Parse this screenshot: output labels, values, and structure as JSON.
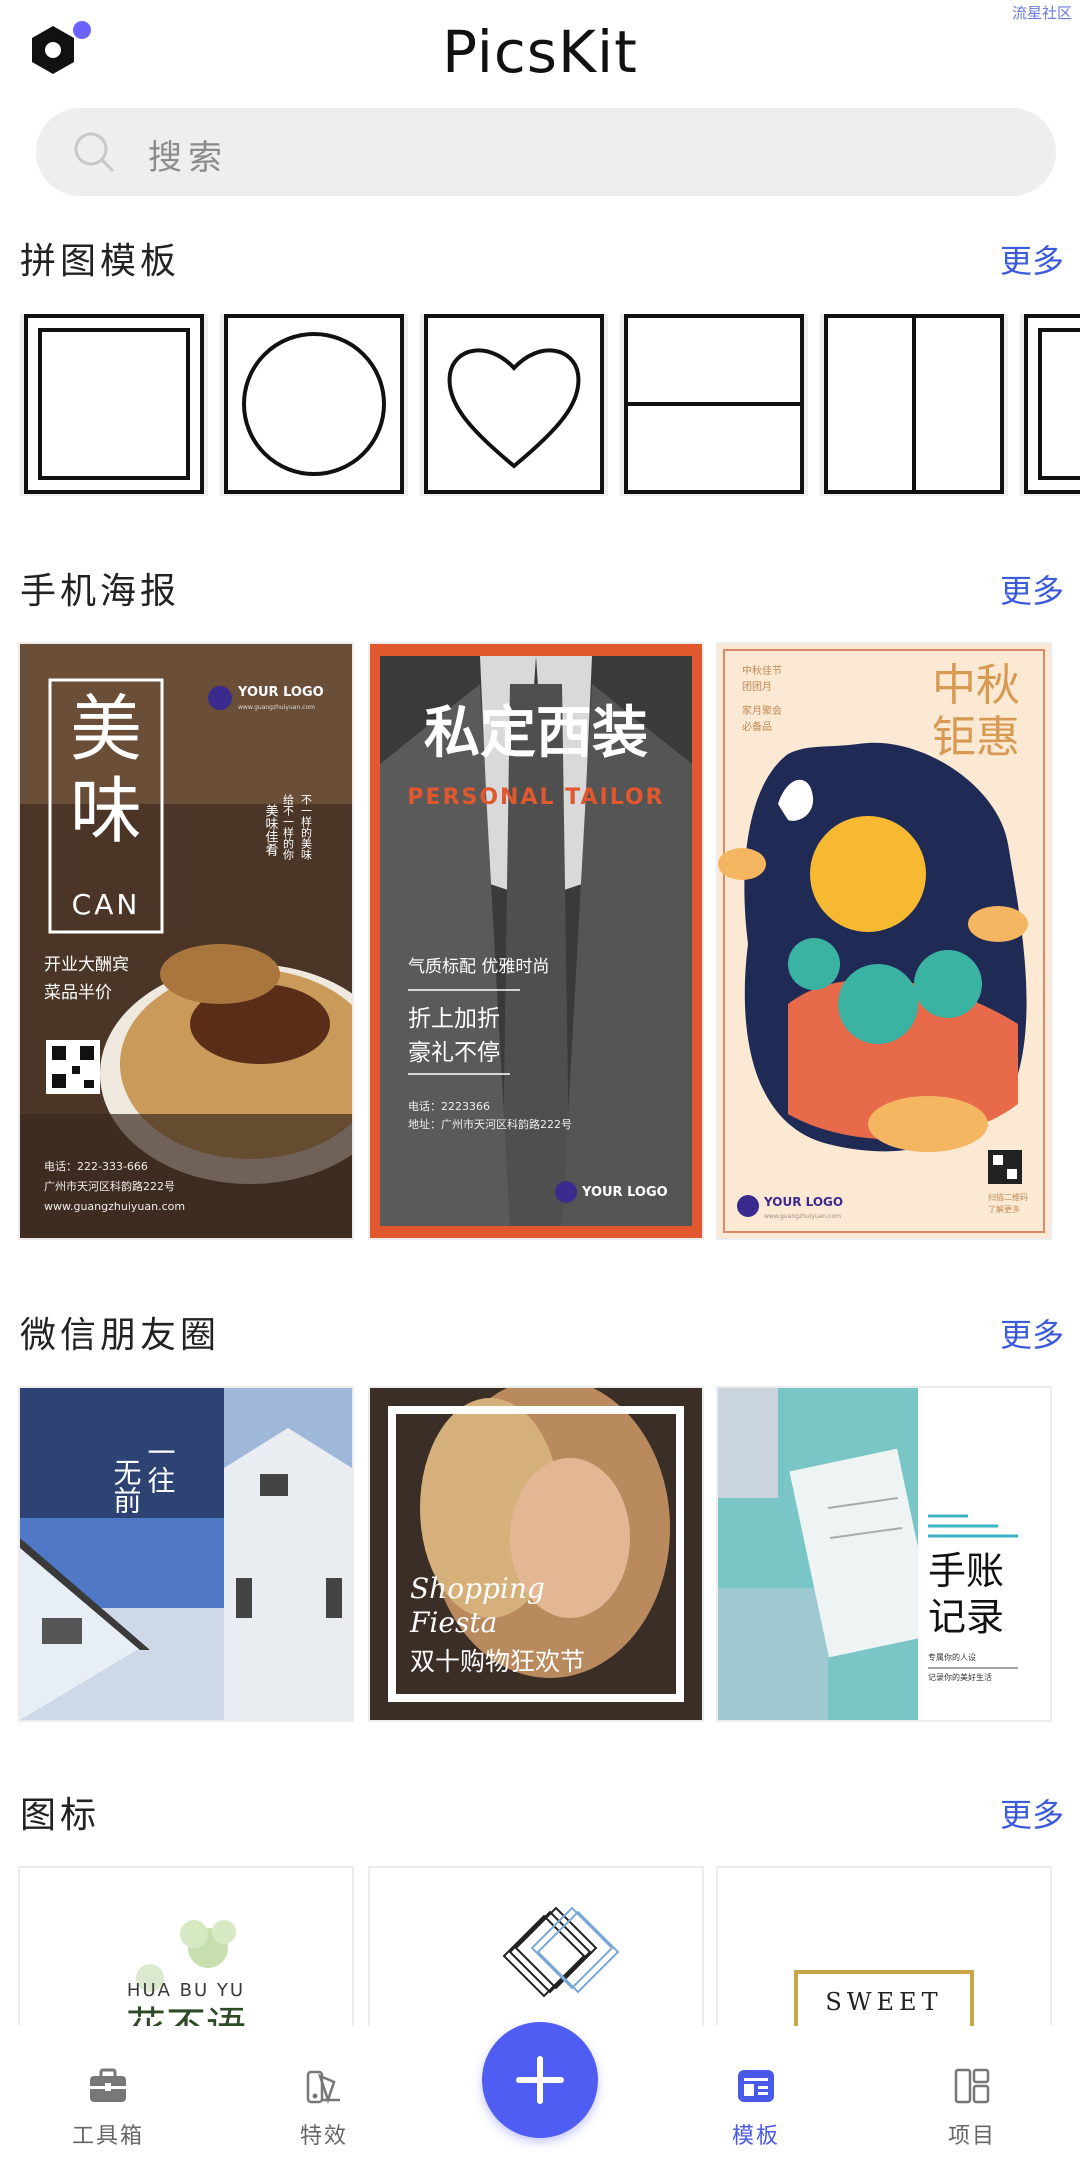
{
  "watermark": "流星社区",
  "app": {
    "title": "PicsKit"
  },
  "search": {
    "placeholder": "搜索"
  },
  "sections": {
    "collage": {
      "title": "拼图模板",
      "more": "更多"
    },
    "poster": {
      "title": "手机海报",
      "more": "更多"
    },
    "moments": {
      "title": "微信朋友圈",
      "more": "更多"
    },
    "icons": {
      "title": "图标",
      "more": "更多"
    }
  },
  "collage_templates": [
    "square-frame",
    "circle",
    "heart",
    "split-horizontal",
    "split-vertical",
    "square-frame"
  ],
  "posters": [
    {
      "title_1": "美",
      "title_2": "味",
      "en": "CAN",
      "logo": "YOUR LOGO",
      "url": "www.guangzhuiyuan.com",
      "side_1": "美味佳肴",
      "side_2": "不一样的美味",
      "side_3": "给不一样的你",
      "line_1": "开业大酬宾",
      "line_2": "菜品半价",
      "phone": "电话：222-333-666",
      "address": "广州市天河区科韵路222号",
      "site": "www.guangzhuiyuan.com"
    },
    {
      "title": "私定西装",
      "subtitle": "PERSONAL  TAILOR",
      "line_1": "气质标配 优雅时尚",
      "line_2": "折上加折",
      "line_3": "豪礼不停",
      "phone": "电话：2223366",
      "address": "地址：广州市天河区科韵路222号",
      "logo": "YOUR LOGO"
    },
    {
      "top_1": "中秋佳节",
      "top_2": "团团月",
      "top_3": "家月聚会",
      "top_4": "必备品",
      "title_1": "中秋",
      "title_2": "钜惠",
      "logo": "YOUR LOGO",
      "url": "www.guangzhuiyuan.com",
      "qr_caption_1": "扫描二维码",
      "qr_caption_2": "了解更多"
    }
  ],
  "moments": [
    {
      "text_1": "一往",
      "text_2": "无前"
    },
    {
      "script_1": "Shopping",
      "script_2": "Fiesta",
      "cn": "双十购物狂欢节"
    },
    {
      "title_1": "手账",
      "title_2": "记录",
      "small_1": "专属你的人设",
      "small_2": "记录你的美好生活"
    }
  ],
  "icon_cards": [
    {
      "en": "HUA  BU  YU",
      "cn": "花不语"
    },
    {
      "label": ""
    },
    {
      "en": "SWEET"
    }
  ],
  "nav": [
    {
      "label": "工具箱",
      "icon": "toolbox-icon"
    },
    {
      "label": "特效",
      "icon": "effects-icon"
    },
    {
      "label": "模板",
      "icon": "template-icon",
      "active": true
    },
    {
      "label": "项目",
      "icon": "project-icon"
    }
  ],
  "colors": {
    "accent": "#4f5df2",
    "more": "#3b5bdb",
    "nav_active": "#4a5ae8"
  }
}
